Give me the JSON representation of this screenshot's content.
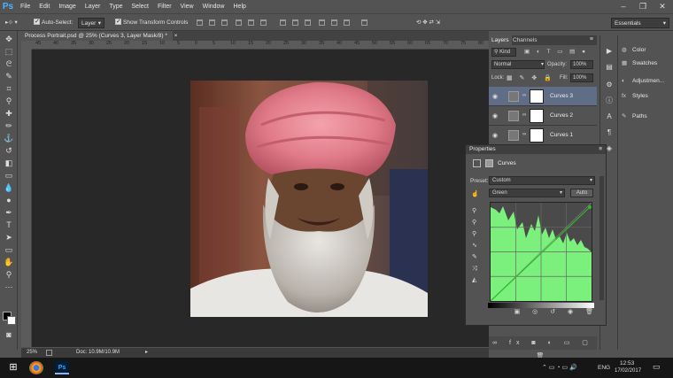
{
  "app": {
    "logo": "Ps",
    "menu": [
      "File",
      "Edit",
      "Image",
      "Layer",
      "Type",
      "Select",
      "Filter",
      "View",
      "Window",
      "Help"
    ]
  },
  "options": {
    "auto_select_label": "Auto-Select:",
    "auto_select_target": "Layer",
    "show_transform_label": "Show Transform Controls",
    "workspace": "Essentials"
  },
  "document": {
    "tab_title": "Process Portrait.psd @ 25% (Curves 3, Layer Mask/8) *",
    "ruler_numbers": [
      "45",
      "40",
      "35",
      "30",
      "25",
      "20",
      "15",
      "10",
      "5",
      "0",
      "5",
      "10",
      "15",
      "20",
      "25",
      "30",
      "35",
      "40",
      "45",
      "50",
      "55",
      "60",
      "65",
      "70",
      "75",
      "80"
    ],
    "zoom": "25%",
    "doc_info": "Doc: 10.9M/10.9M"
  },
  "layers_panel": {
    "tabs": [
      "Layers",
      "Channels"
    ],
    "filter_kind": "Kind",
    "blend_mode": "Normal",
    "opacity_label": "Opacity:",
    "opacity_value": "100%",
    "lock_label": "Lock:",
    "fill_label": "Fill:",
    "fill_value": "100%",
    "layers": [
      {
        "name": "Curves 3",
        "selected": true
      },
      {
        "name": "Curves 2",
        "selected": false
      },
      {
        "name": "Curves 1",
        "selected": false
      }
    ]
  },
  "right_panel": {
    "items": [
      "Color",
      "Swatches",
      "Adjustmen...",
      "Styles",
      "Paths"
    ]
  },
  "properties": {
    "title": "Properties",
    "adjustment": "Curves",
    "preset_label": "Preset:",
    "preset_value": "Custom",
    "channel": "Green",
    "auto_label": "Auto",
    "curve_color": "#7cf07c"
  },
  "taskbar": {
    "language": "ENG",
    "time": "12:53",
    "date": "17/02/2017"
  }
}
